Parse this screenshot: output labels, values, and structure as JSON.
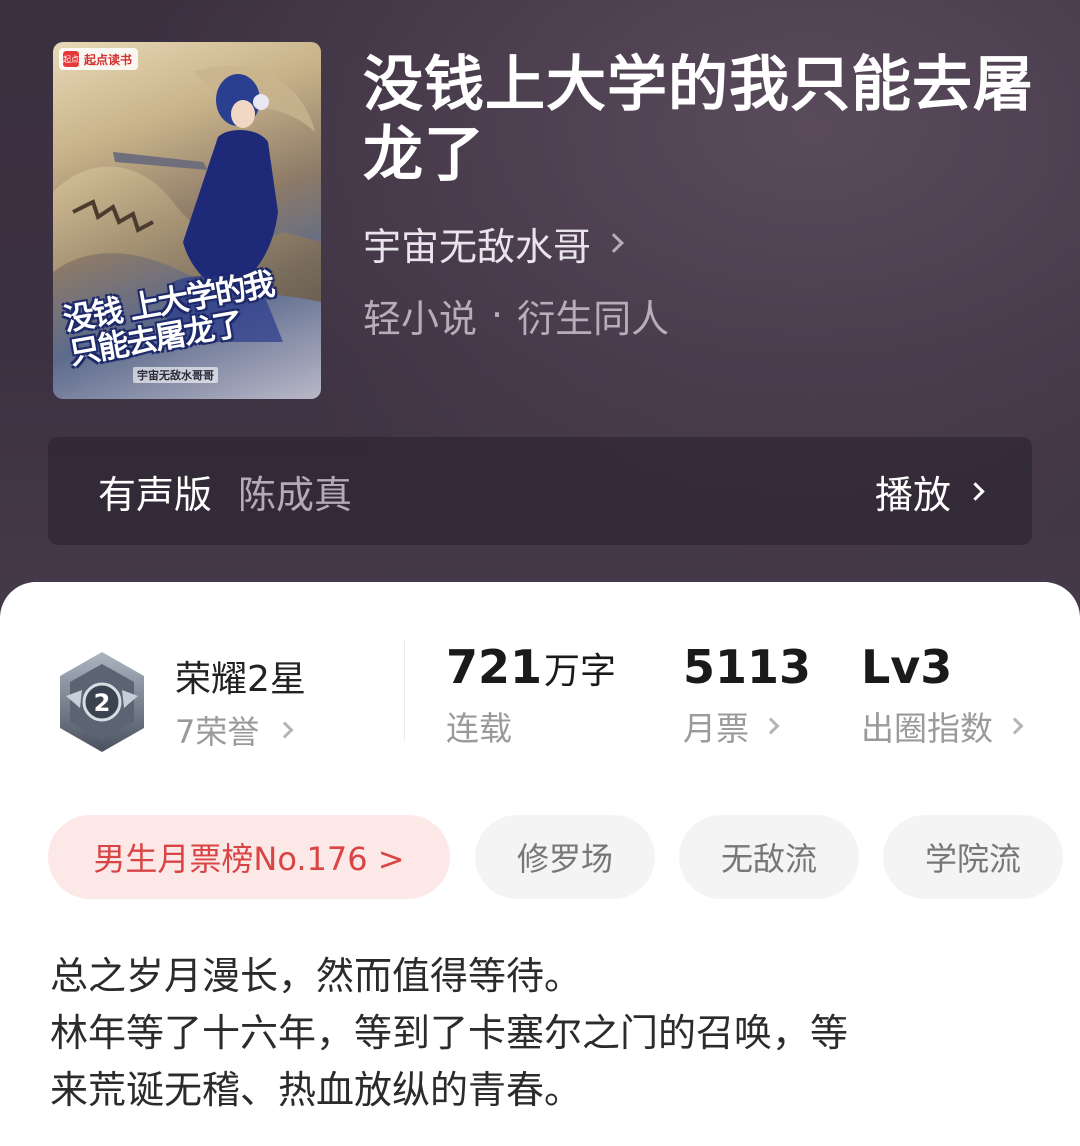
{
  "cover": {
    "logo": "起点读书",
    "logo_mark": "起点",
    "title_line1": "没钱 上大学的我",
    "title_line2": "只能去屠龙了",
    "author": "宇宙无敌水哥哥"
  },
  "book": {
    "title": "没钱上大学的我只能去屠龙了",
    "author": "宇宙无敌水哥",
    "genre_main": "轻小说",
    "genre_sep": "·",
    "genre_sub": "衍生同人"
  },
  "audio": {
    "label": "有声版",
    "narrator": "陈成真",
    "play": "播放"
  },
  "honor": {
    "title": "荣耀2星",
    "sub": "7荣誉",
    "medal_number": "2"
  },
  "stats": {
    "words_value": "721",
    "words_unit": "万字",
    "words_label": "连载",
    "tickets_value": "5113",
    "tickets_label": "月票",
    "level_value": "Lv3",
    "level_label": "出圈指数"
  },
  "tags": {
    "rank": "男生月票榜No.176 >",
    "t1": "修罗场",
    "t2": "无敌流",
    "t3": "学院流"
  },
  "description": {
    "line1": "总之岁月漫长，然而值得等待。",
    "line2": "林年等了十六年，等到了卡塞尔之门的召唤，等",
    "line3": "来荒诞无稽、热血放纵的青春。"
  },
  "colors": {
    "accent_red": "#d94545",
    "header_bg": "#3c3142"
  }
}
